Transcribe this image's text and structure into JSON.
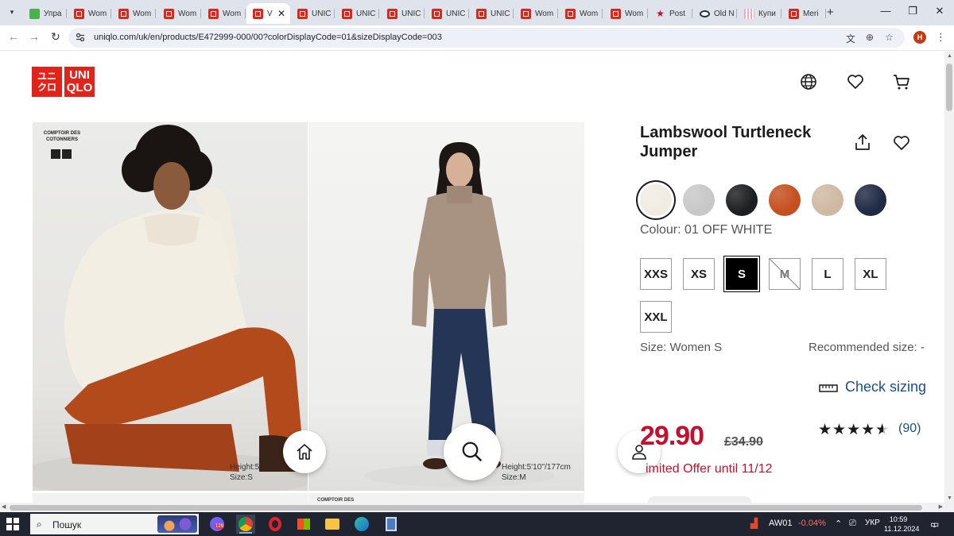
{
  "browser": {
    "tabs": [
      {
        "label": "Упра",
        "icon": "green"
      },
      {
        "label": "Wom",
        "icon": "uniqlo"
      },
      {
        "label": "Wom",
        "icon": "uniqlo"
      },
      {
        "label": "Wom",
        "icon": "uniqlo"
      },
      {
        "label": "Wom",
        "icon": "uniqlo"
      },
      {
        "label": "V",
        "icon": "uniqlo",
        "active": true
      },
      {
        "label": "UNIC",
        "icon": "uniqlo"
      },
      {
        "label": "UNIC",
        "icon": "uniqlo"
      },
      {
        "label": "UNIC",
        "icon": "uniqlo"
      },
      {
        "label": "UNIC",
        "icon": "uniqlo"
      },
      {
        "label": "UNIC",
        "icon": "uniqlo"
      },
      {
        "label": "Wom",
        "icon": "uniqlo"
      },
      {
        "label": "Wom",
        "icon": "uniqlo"
      },
      {
        "label": "Wom",
        "icon": "uniqlo"
      },
      {
        "label": "Post",
        "icon": "star"
      },
      {
        "label": "Old N",
        "icon": "oval"
      },
      {
        "label": "Купи",
        "icon": "pink"
      },
      {
        "label": "Meri",
        "icon": "red"
      }
    ],
    "new_tab": "+",
    "url": "uniqlo.com/uk/en/products/E472999-000/00?colorDisplayCode=01&sizeDisplayCode=003",
    "profile_initial": "H"
  },
  "site": {
    "logo_top": "ユニ\nクロ",
    "logo_bottom": "UNI\nQLO"
  },
  "gallery": {
    "brand_small": "COMPTOIR DES\nCOTONNIERS",
    "left_caption_height": "Height:5'",
    "left_caption_size": "Size:S",
    "right_caption_height": "Height:5'10''/177cm",
    "right_caption_size": "Size:M",
    "next_strip": "COMPTOIR DES"
  },
  "product": {
    "title": "Lambswool Turtleneck Jumper",
    "colours": [
      {
        "name": "off-white",
        "hex": "#f1ece2",
        "selected": true
      },
      {
        "name": "grey",
        "hex": "#c8c8c8"
      },
      {
        "name": "black",
        "hex": "#1d1e20"
      },
      {
        "name": "orange",
        "hex": "#c5501f"
      },
      {
        "name": "beige",
        "hex": "#cfb9a3"
      },
      {
        "name": "navy",
        "hex": "#1f2a44"
      }
    ],
    "colour_label": "Colour: 01 OFF WHITE",
    "sizes": [
      {
        "label": "XXS",
        "state": "available"
      },
      {
        "label": "XS",
        "state": "available"
      },
      {
        "label": "S",
        "state": "selected"
      },
      {
        "label": "M",
        "state": "unavailable"
      },
      {
        "label": "L",
        "state": "available"
      },
      {
        "label": "XL",
        "state": "available"
      },
      {
        "label": "XXL",
        "state": "available"
      }
    ],
    "size_label": "Size: Women S",
    "recommended_size": "Recommended size: -",
    "check_sizing": "Check sizing",
    "price": "£29.90",
    "price_visible": "29.90",
    "old_price": "£34.90",
    "rating": 4.5,
    "stars_text": "★★★★★",
    "reviews": "(90)",
    "offer": "Limited Offer until 11/12",
    "offer_visible": "imited Offer until 11/12"
  },
  "taskbar": {
    "search_placeholder": "Пошук",
    "badge": "129",
    "ticker": "AW01",
    "ticker_change": "-0.04%",
    "lang": "УКР",
    "time": "10:59",
    "date": "11.12.2024",
    "notif_count": "1"
  },
  "colors": {
    "brand_red": "#e2231a",
    "sale_red": "#c3112d",
    "link_blue": "#1b4f87"
  }
}
